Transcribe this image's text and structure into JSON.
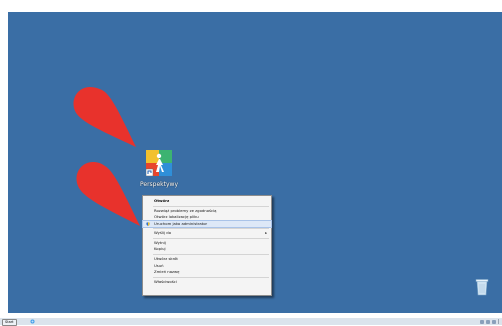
{
  "desktop": {
    "background_color": "#3a6ea5",
    "annotation_color": "#e8322c"
  },
  "app_icon": {
    "label": "Perspektywy",
    "icon": "perspektywy-app-icon"
  },
  "context_menu": {
    "items": [
      {
        "label": "Otwórz",
        "bold": true
      },
      {
        "label": "Rozwiąż problemy ze zgodnością"
      },
      {
        "label": "Otwórz lokalizację pliku"
      },
      {
        "label": "Uruchom jako administrator",
        "icon": "uac-shield-icon",
        "highlighted": true
      },
      {
        "label": "Wyślij do",
        "submenu": true
      },
      {
        "label": "Wytnij"
      },
      {
        "label": "Kopiuj"
      },
      {
        "label": "Utwórz skrót"
      },
      {
        "label": "Usuń"
      },
      {
        "label": "Zmień nazwę"
      },
      {
        "label": "Właściwości"
      }
    ],
    "submenu_arrow": "▸"
  },
  "taskbar": {
    "start_label": "Start",
    "clock_time": "",
    "clock_date": ""
  }
}
